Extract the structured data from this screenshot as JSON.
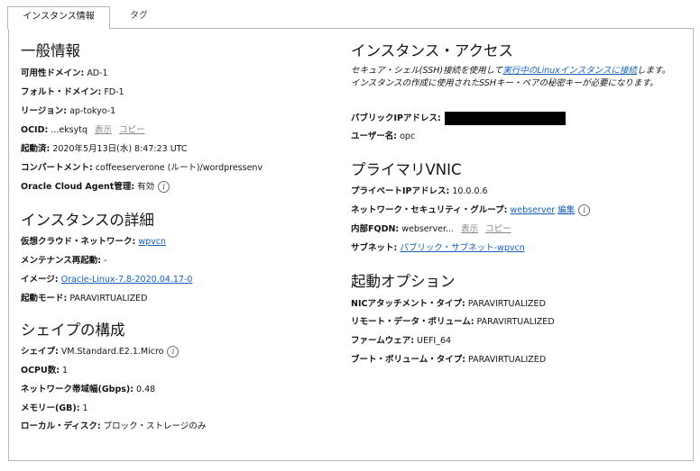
{
  "tabs": [
    {
      "label": "インスタンス情報",
      "active": true
    },
    {
      "label": "タグ",
      "active": false
    }
  ],
  "general": {
    "heading": "一般情報",
    "availability_domain": {
      "label": "可用性ドメイン:",
      "value": "AD-1"
    },
    "fault_domain": {
      "label": "フォルト・ドメイン:",
      "value": "FD-1"
    },
    "region": {
      "label": "リージョン:",
      "value": "ap-tokyo-1"
    },
    "ocid": {
      "label": "OCID:",
      "value": "...eksytq",
      "show": "表示",
      "copy": "コピー"
    },
    "launched": {
      "label": "起動済:",
      "value": "2020年5月13日(水) 8:47:23 UTC"
    },
    "compartment": {
      "label": "コンパートメント:",
      "value": "coffeeserverone (ルート)/wordpressenv"
    },
    "agent": {
      "label": "Oracle Cloud Agent管理:",
      "value": "有効"
    }
  },
  "details": {
    "heading": "インスタンスの詳細",
    "vcn": {
      "label": "仮想クラウド・ネットワーク:",
      "value": "wpvcn"
    },
    "maintenance": {
      "label": "メンテナンス再起動:",
      "value": "-"
    },
    "image": {
      "label": "イメージ:",
      "value": "Oracle-Linux-7.8-2020.04.17-0"
    },
    "launch_mode": {
      "label": "起動モード:",
      "value": "PARAVIRTUALIZED"
    }
  },
  "shape": {
    "heading": "シェイプの構成",
    "shape": {
      "label": "シェイプ:",
      "value": "VM.Standard.E2.1.Micro"
    },
    "ocpu": {
      "label": "OCPU数:",
      "value": "1"
    },
    "bandwidth": {
      "label": "ネットワーク帯域幅(Gbps):",
      "value": "0.48"
    },
    "memory": {
      "label": "メモリー(GB):",
      "value": "1"
    },
    "local_disk": {
      "label": "ローカル・ディスク:",
      "value": "ブロック・ストレージのみ"
    }
  },
  "access": {
    "heading": "インスタンス・アクセス",
    "desc_before": "セキュア・シェル(SSH)接続を使用して",
    "desc_link": "実行中のLinuxインスタンスに接続",
    "desc_after": "します。インスタンスの作成に使用されたSSHキー・ペアの秘密キーが必要になります。",
    "public_ip": {
      "label": "パブリックIPアドレス:"
    },
    "username": {
      "label": "ユーザー名:",
      "value": "opc"
    }
  },
  "vnic": {
    "heading": "プライマリVNIC",
    "private_ip": {
      "label": "プライベートIPアドレス:",
      "value": "10.0.0.6"
    },
    "nsg": {
      "label": "ネットワーク・セキュリティ・グループ:",
      "value": "webserver",
      "edit": "編集"
    },
    "fqdn": {
      "label": "内部FQDN:",
      "value": "webserver...",
      "show": "表示",
      "copy": "コピー"
    },
    "subnet": {
      "label": "サブネット:",
      "value": "パブリック・サブネット-wpvcn"
    }
  },
  "boot": {
    "heading": "起動オプション",
    "nic_type": {
      "label": "NICアタッチメント・タイプ:",
      "value": "PARAVIRTUALIZED"
    },
    "remote_volume": {
      "label": "リモート・データ・ボリューム:",
      "value": "PARAVIRTUALIZED"
    },
    "firmware": {
      "label": "ファームウェア:",
      "value": "UEFI_64"
    },
    "boot_volume_type": {
      "label": "ブート・ボリューム・タイプ:",
      "value": "PARAVIRTUALIZED"
    }
  }
}
